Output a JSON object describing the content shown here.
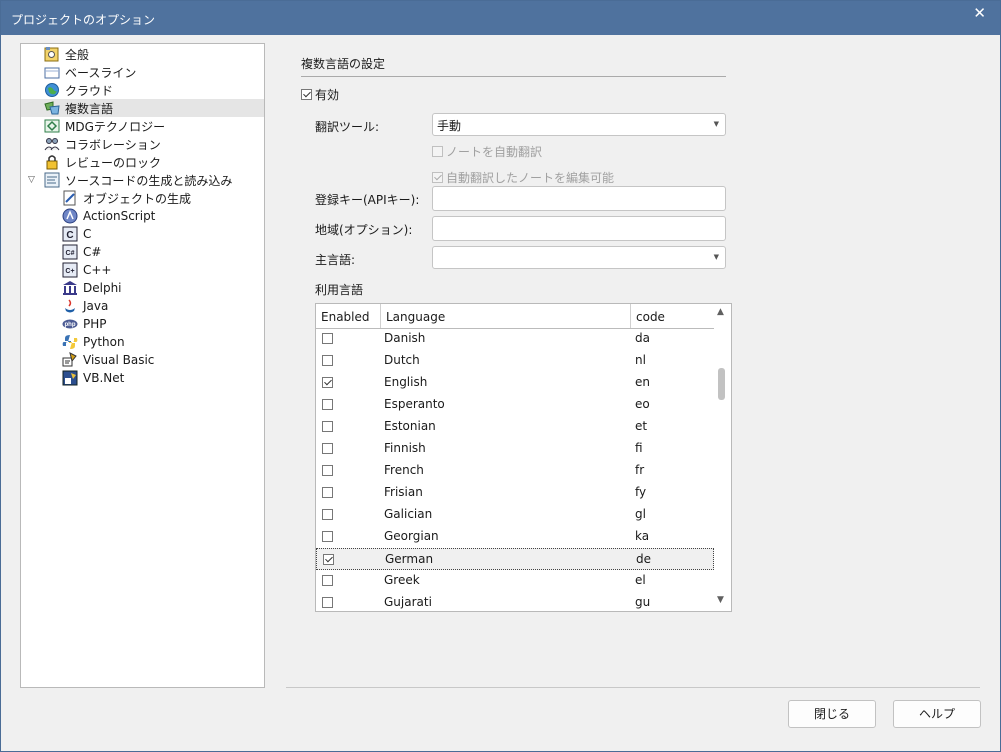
{
  "window": {
    "title": "プロジェクトのオプション",
    "close_glyph": "✕"
  },
  "tree": {
    "items": [
      {
        "label": "全般",
        "icon": "settings-icon"
      },
      {
        "label": "ベースライン",
        "icon": "baseline-icon"
      },
      {
        "label": "クラウド",
        "icon": "cloud-globe-icon"
      },
      {
        "label": "複数言語",
        "icon": "multilanguage-icon"
      },
      {
        "label": "MDGテクノロジー",
        "icon": "mdg-icon"
      },
      {
        "label": "コラボレーション",
        "icon": "collaboration-icon"
      },
      {
        "label": "レビューのロック",
        "icon": "lock-icon"
      },
      {
        "label": "ソースコードの生成と読み込み",
        "icon": "source-code-icon"
      },
      {
        "label": "オブジェクトの生成",
        "icon": "object-generation-icon"
      },
      {
        "label": "ActionScript",
        "icon": "actionscript-icon"
      },
      {
        "label": "C",
        "icon": "c-language-icon"
      },
      {
        "label": "C#",
        "icon": "csharp-icon"
      },
      {
        "label": "C++",
        "icon": "cpp-icon"
      },
      {
        "label": "Delphi",
        "icon": "delphi-icon"
      },
      {
        "label": "Java",
        "icon": "java-icon"
      },
      {
        "label": "PHP",
        "icon": "php-icon"
      },
      {
        "label": "Python",
        "icon": "python-icon"
      },
      {
        "label": "Visual Basic",
        "icon": "visual-basic-icon"
      },
      {
        "label": "VB.Net",
        "icon": "vbnet-icon"
      }
    ],
    "c_glyph": "C",
    "csharp_glyph": "C#",
    "cpp_glyph": "C+",
    "php_glyph": "php"
  },
  "panel": {
    "section_title": "複数言語の設定",
    "enabled_label": "有効",
    "translate_tool_label": "翻訳ツール:",
    "translate_tool_value": "手動",
    "auto_translate_notes": "ノートを自動翻訳",
    "auto_translate_editable": "自動翻訳したノートを編集可能",
    "api_key_label": "登録キー(APIキー):",
    "api_key_value": "",
    "region_label": "地域(オプション):",
    "region_value": "",
    "primary_lang_label": "主言語:",
    "primary_lang_value": "",
    "languages_label": "利用言語"
  },
  "grid": {
    "headers": {
      "enabled": "Enabled",
      "language": "Language",
      "code": "code"
    },
    "rows": [
      {
        "language": "Danish",
        "code": "da",
        "enabled": false
      },
      {
        "language": "Dutch",
        "code": "nl",
        "enabled": false
      },
      {
        "language": "English",
        "code": "en",
        "enabled": true
      },
      {
        "language": "Esperanto",
        "code": "eo",
        "enabled": false
      },
      {
        "language": "Estonian",
        "code": "et",
        "enabled": false
      },
      {
        "language": "Finnish",
        "code": "fi",
        "enabled": false
      },
      {
        "language": "French",
        "code": "fr",
        "enabled": false
      },
      {
        "language": "Frisian",
        "code": "fy",
        "enabled": false
      },
      {
        "language": "Galician",
        "code": "gl",
        "enabled": false
      },
      {
        "language": "Georgian",
        "code": "ka",
        "enabled": false
      },
      {
        "language": "German",
        "code": "de",
        "enabled": true
      },
      {
        "language": "Greek",
        "code": "el",
        "enabled": false
      },
      {
        "language": "Gujarati",
        "code": "gu",
        "enabled": false
      }
    ]
  },
  "buttons": {
    "close": "閉じる",
    "help": "ヘルプ"
  }
}
